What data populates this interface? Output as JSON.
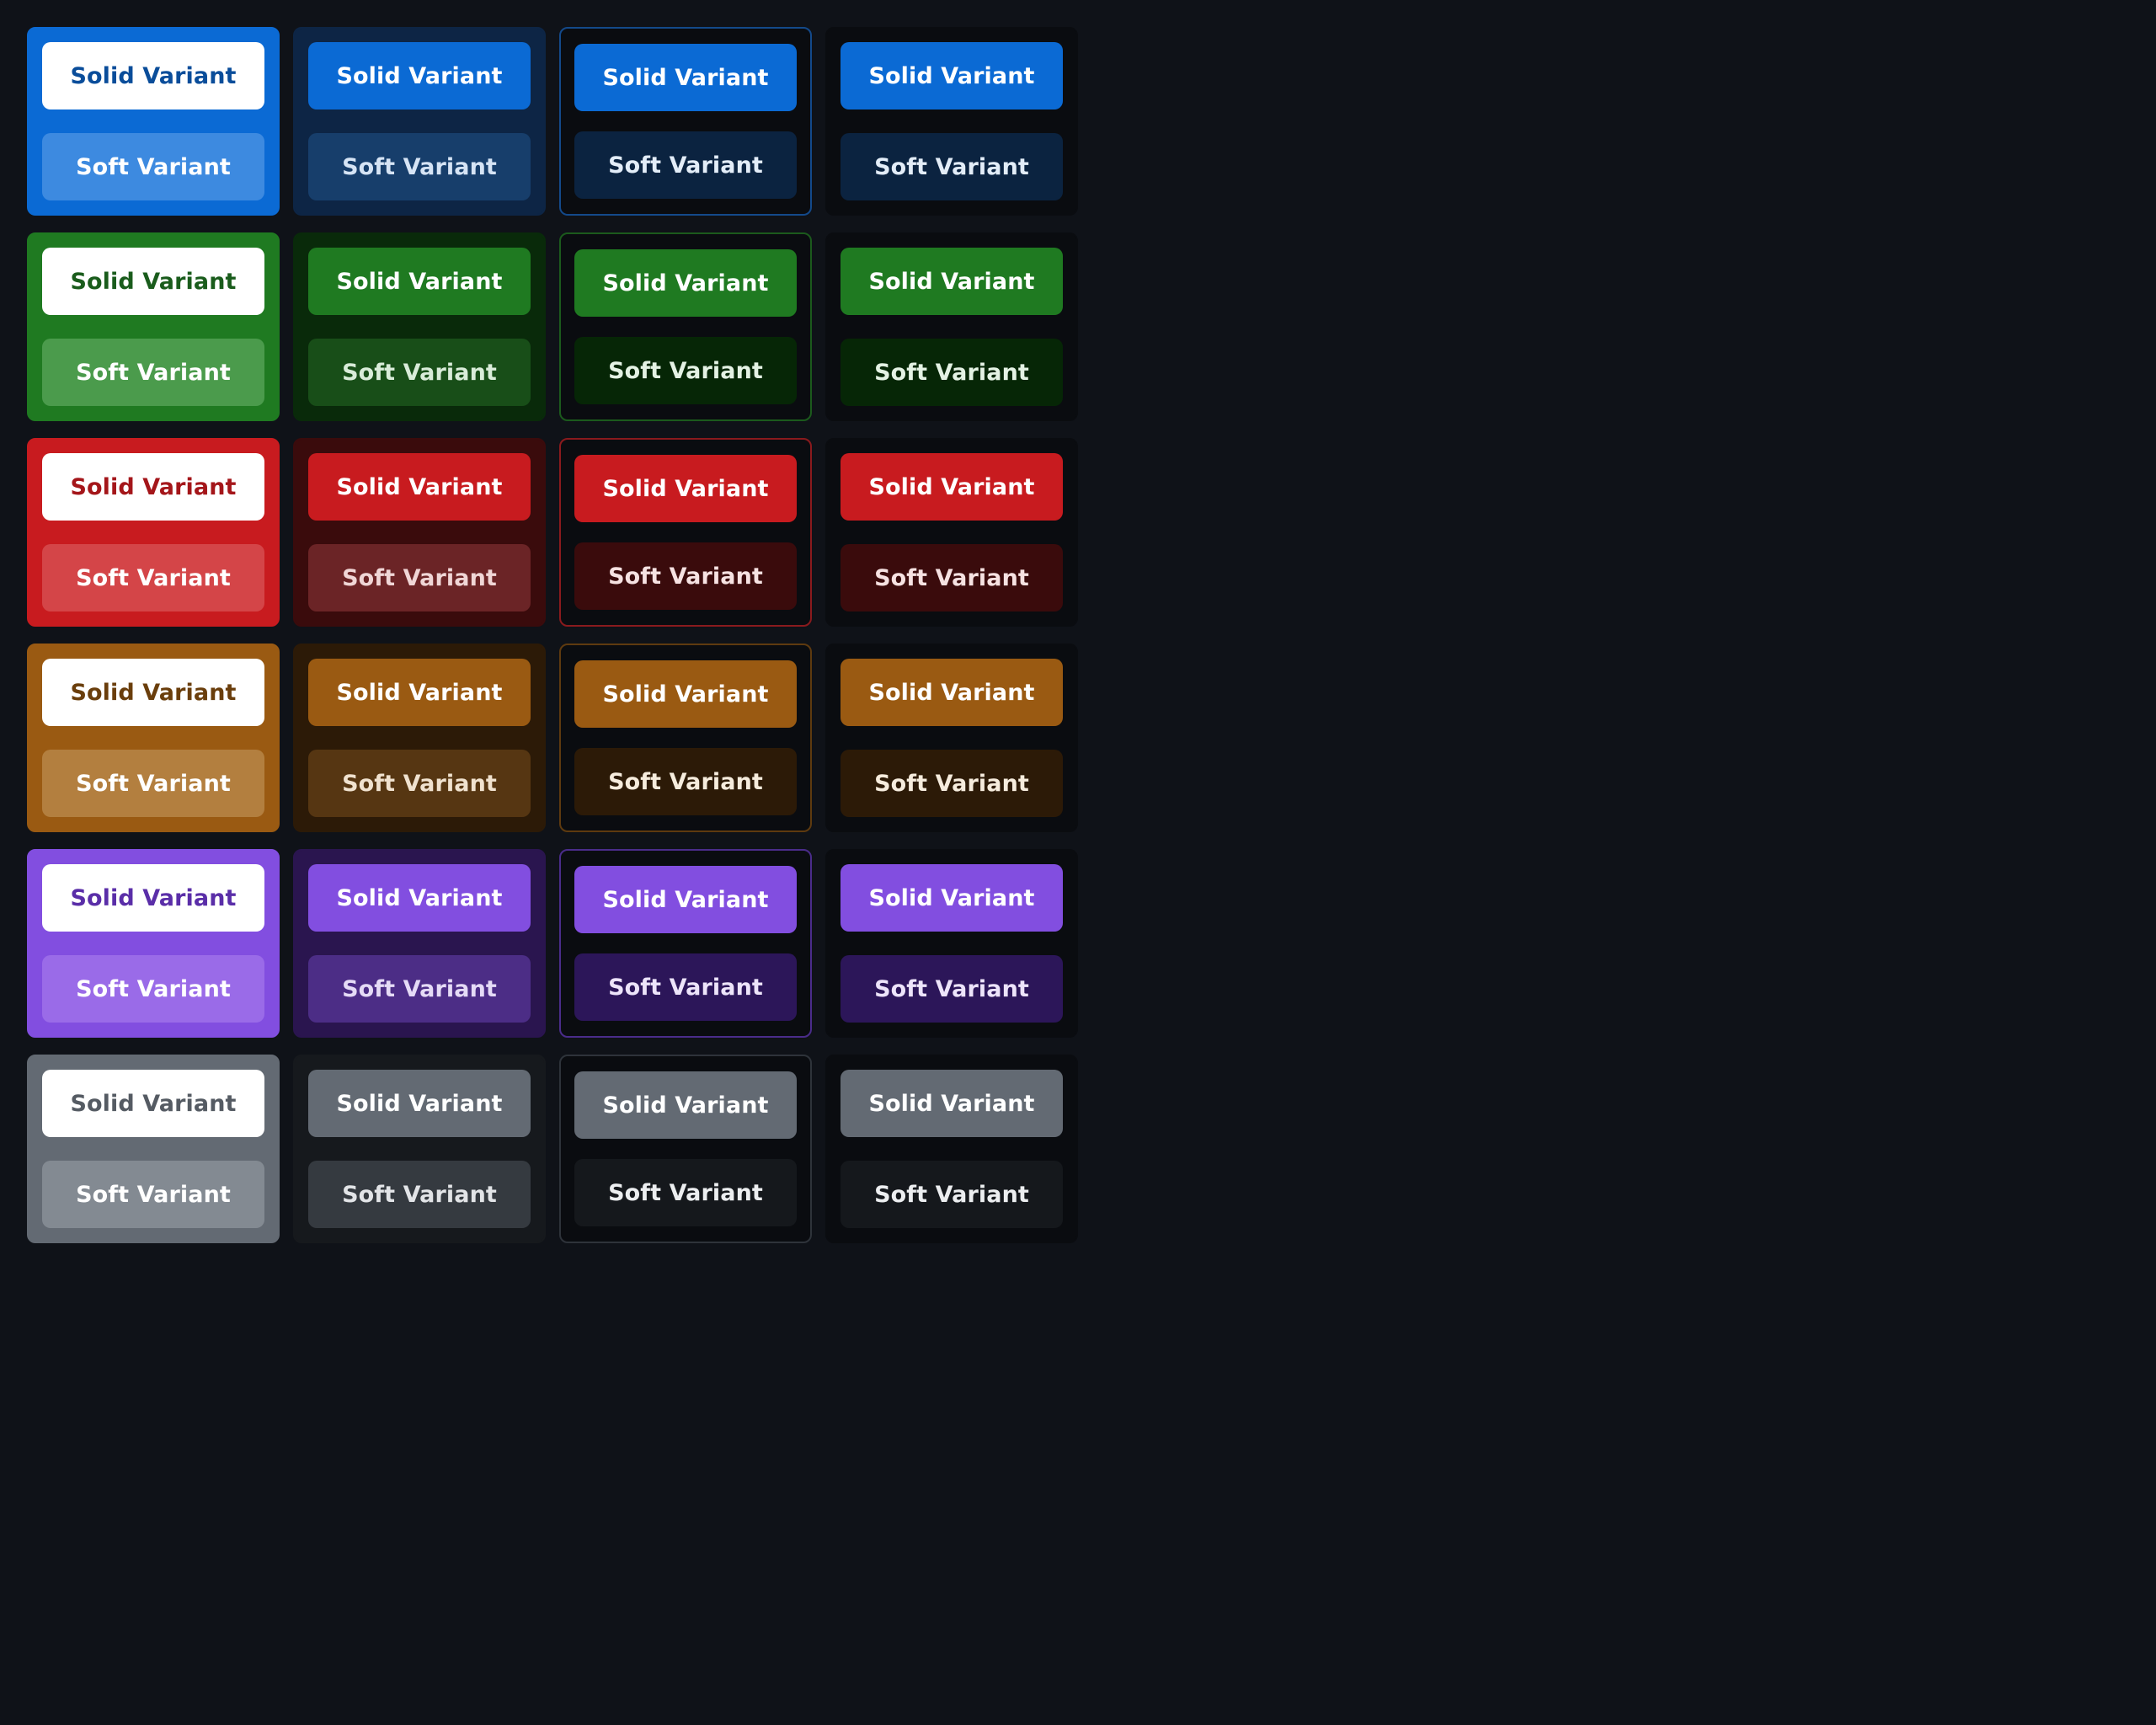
{
  "labels": {
    "solid": "Solid Variant",
    "soft": "Soft Variant"
  },
  "rows": [
    {
      "name": "blue",
      "cards": [
        {
          "style": "filled",
          "bg": "#0b6ad4",
          "border": "#0b6ad4",
          "solid_bg": "#ffffff",
          "solid_fg": "#0a4d9a",
          "soft_bg": "#3d8ae0",
          "soft_fg": "#ffffff"
        },
        {
          "style": "tinted",
          "bg": "#0d2545",
          "border": "#0d2545",
          "solid_bg": "#0b6ad4",
          "solid_fg": "#ffffff",
          "soft_bg": "#173e6b",
          "soft_fg": "#d6e4f5"
        },
        {
          "style": "outlined",
          "bg": "#0a0c10",
          "border": "#13498a",
          "solid_bg": "#0b6ad4",
          "solid_fg": "#ffffff",
          "soft_bg": "#0b2340",
          "soft_fg": "#e3edf8"
        },
        {
          "style": "plain",
          "bg": "#0a0c10",
          "border": "#0a0c10",
          "solid_bg": "#0b6ad4",
          "solid_fg": "#ffffff",
          "soft_bg": "#0b2340",
          "soft_fg": "#e3edf8"
        }
      ]
    },
    {
      "name": "green",
      "cards": [
        {
          "style": "filled",
          "bg": "#1f7a21",
          "border": "#1f7a21",
          "solid_bg": "#ffffff",
          "solid_fg": "#1a5c1c",
          "soft_bg": "#4b9b4c",
          "soft_fg": "#ffffff"
        },
        {
          "style": "tinted",
          "bg": "#092a0a",
          "border": "#092a0a",
          "solid_bg": "#1f7a21",
          "solid_fg": "#ffffff",
          "soft_bg": "#184e18",
          "soft_fg": "#d9ecd9"
        },
        {
          "style": "outlined",
          "bg": "#0a0c10",
          "border": "#1b5a1c",
          "solid_bg": "#1f7a21",
          "solid_fg": "#ffffff",
          "soft_bg": "#062606",
          "soft_fg": "#e4f2e4"
        },
        {
          "style": "plain",
          "bg": "#0a0c10",
          "border": "#0a0c10",
          "solid_bg": "#1f7a21",
          "solid_fg": "#ffffff",
          "soft_bg": "#062606",
          "soft_fg": "#e4f2e4"
        }
      ]
    },
    {
      "name": "red",
      "cards": [
        {
          "style": "filled",
          "bg": "#c81b1f",
          "border": "#c81b1f",
          "solid_bg": "#ffffff",
          "solid_fg": "#a4161a",
          "soft_bg": "#d44548",
          "soft_fg": "#ffffff"
        },
        {
          "style": "tinted",
          "bg": "#3a0b0c",
          "border": "#3a0b0c",
          "solid_bg": "#c81b1f",
          "solid_fg": "#ffffff",
          "soft_bg": "#6b2426",
          "soft_fg": "#f0d6d6"
        },
        {
          "style": "outlined",
          "bg": "#0a0c10",
          "border": "#8a1a1d",
          "solid_bg": "#c81b1f",
          "solid_fg": "#ffffff",
          "soft_bg": "#3a0b0c",
          "soft_fg": "#f6e2e2"
        },
        {
          "style": "plain",
          "bg": "#0a0c10",
          "border": "#0a0c10",
          "solid_bg": "#c81b1f",
          "solid_fg": "#ffffff",
          "soft_bg": "#3a0b0c",
          "soft_fg": "#f6e2e2"
        }
      ]
    },
    {
      "name": "orange",
      "cards": [
        {
          "style": "filled",
          "bg": "#9a5a12",
          "border": "#9a5a12",
          "solid_bg": "#ffffff",
          "solid_fg": "#6a3e0c",
          "soft_bg": "#b37f3f",
          "soft_fg": "#ffffff"
        },
        {
          "style": "tinted",
          "bg": "#2c1a07",
          "border": "#2c1a07",
          "solid_bg": "#9a5a12",
          "solid_fg": "#ffffff",
          "soft_bg": "#563612",
          "soft_fg": "#f0e2cf"
        },
        {
          "style": "outlined",
          "bg": "#0a0c10",
          "border": "#5e3a0f",
          "solid_bg": "#9a5a12",
          "solid_fg": "#ffffff",
          "soft_bg": "#2c1a07",
          "soft_fg": "#f6ecdd"
        },
        {
          "style": "plain",
          "bg": "#0a0c10",
          "border": "#0a0c10",
          "solid_bg": "#9a5a12",
          "solid_fg": "#ffffff",
          "soft_bg": "#2c1a07",
          "soft_fg": "#f6ecdd"
        }
      ]
    },
    {
      "name": "purple",
      "cards": [
        {
          "style": "filled",
          "bg": "#824ee0",
          "border": "#824ee0",
          "solid_bg": "#ffffff",
          "solid_fg": "#5a2ea8",
          "soft_bg": "#9a6be8",
          "soft_fg": "#ffffff"
        },
        {
          "style": "tinted",
          "bg": "#2a154f",
          "border": "#2a154f",
          "solid_bg": "#824ee0",
          "solid_fg": "#ffffff",
          "soft_bg": "#4c2d86",
          "soft_fg": "#e5dbf6"
        },
        {
          "style": "outlined",
          "bg": "#0a0c10",
          "border": "#4a2c8a",
          "solid_bg": "#824ee0",
          "solid_fg": "#ffffff",
          "soft_bg": "#2c1659",
          "soft_fg": "#ede4fa"
        },
        {
          "style": "plain",
          "bg": "#0a0c10",
          "border": "#0a0c10",
          "solid_bg": "#824ee0",
          "solid_fg": "#ffffff",
          "soft_bg": "#2c1659",
          "soft_fg": "#ede4fa"
        }
      ]
    },
    {
      "name": "gray",
      "cards": [
        {
          "style": "filled",
          "bg": "#636a73",
          "border": "#636a73",
          "solid_bg": "#ffffff",
          "solid_fg": "#555b63",
          "soft_bg": "#838a92",
          "soft_fg": "#ffffff"
        },
        {
          "style": "tinted",
          "bg": "#16191d",
          "border": "#16191d",
          "solid_bg": "#636a73",
          "solid_fg": "#ffffff",
          "soft_bg": "#353a40",
          "soft_fg": "#e2e4e7"
        },
        {
          "style": "outlined",
          "bg": "#0a0c10",
          "border": "#2e333a",
          "solid_bg": "#636a73",
          "solid_fg": "#ffffff",
          "soft_bg": "#15181c",
          "soft_fg": "#eceef0"
        },
        {
          "style": "plain",
          "bg": "#0a0c10",
          "border": "#0a0c10",
          "solid_bg": "#636a73",
          "solid_fg": "#ffffff",
          "soft_bg": "#15181c",
          "soft_fg": "#eceef0"
        }
      ]
    }
  ]
}
